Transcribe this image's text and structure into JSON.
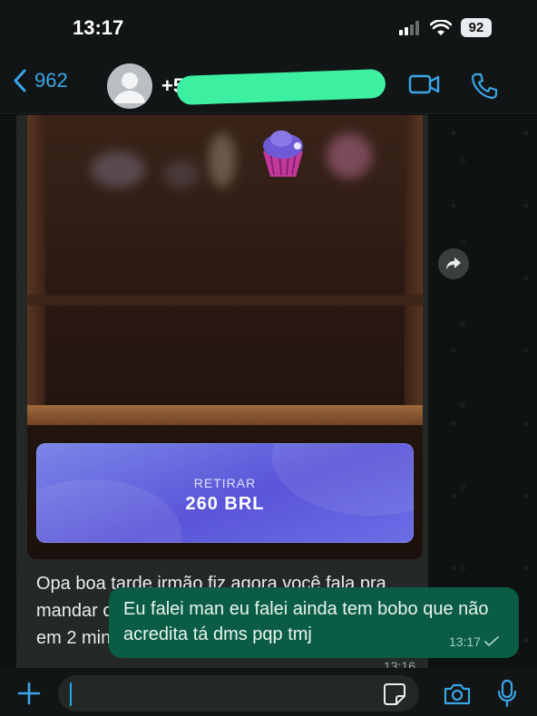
{
  "status_bar": {
    "time": "13:17",
    "battery": "92"
  },
  "header": {
    "back_count": "962",
    "contact_name": "+5"
  },
  "messages": {
    "incoming": {
      "withdraw_label": "RETIRAR",
      "withdraw_amount": "260 BRL",
      "text": "Opa boa tarde irmão fiz agora você fala pra mandar o resultado tá aí coloquei 30 fiz 260 em 2 minutos tá incrível parabéns 🙏",
      "time": "13:16"
    },
    "outgoing": {
      "text": "Eu falei man eu falei ainda tem bobo que não acredita tá dms pqp tmj",
      "time": "13:17"
    }
  },
  "input": {
    "placeholder": ""
  },
  "colors": {
    "accent": "#3aa6e8",
    "outgoing_bubble": "#0a5c45",
    "incoming_bubble": "#242826",
    "withdraw_button": "#5a55d8"
  },
  "icons": [
    "back-chevron-icon",
    "video-call-icon",
    "phone-icon",
    "forward-icon",
    "plus-icon",
    "sticker-icon",
    "camera-icon",
    "microphone-icon",
    "read-check-icon"
  ]
}
